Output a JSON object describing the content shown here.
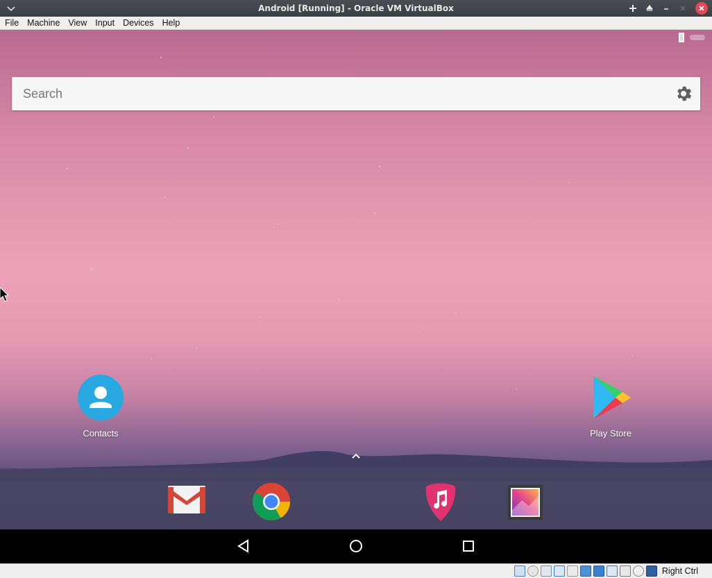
{
  "window": {
    "title": "Android [Running] - Oracle VM VirtualBox"
  },
  "menu": [
    "File",
    "Machine",
    "View",
    "Input",
    "Devices",
    "Help"
  ],
  "search": {
    "placeholder": "Search"
  },
  "apps": {
    "contacts": "Contacts",
    "playstore": "Play Store"
  },
  "dock": [
    "gmail-icon",
    "chrome-icon",
    "music-icon",
    "gallery-icon"
  ],
  "navbar": [
    "back-icon",
    "home-icon",
    "recent-apps-icon"
  ],
  "status": {
    "host_key": "Right Ctrl"
  },
  "colors": {
    "title_bg": "#3c3f44",
    "close_button": "#e0475a",
    "contacts_blue": "#29a9e1",
    "music_pink": "#e0336f"
  }
}
